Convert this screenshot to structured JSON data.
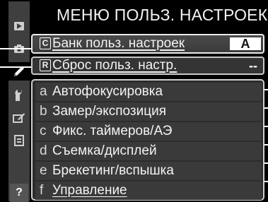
{
  "menu": {
    "title": "МЕНЮ ПОЛЬЗ. НАСТРОЕК",
    "bank_row": {
      "badge": "C",
      "label": "Банк польз. настроек",
      "value": "A"
    },
    "reset_row": {
      "badge": "R",
      "label": "Сброс польз. настр.",
      "value": "--"
    },
    "groups": [
      {
        "letter": "a",
        "label": "Автофокусировка"
      },
      {
        "letter": "b",
        "label": "Замер/экспозиция"
      },
      {
        "letter": "c",
        "label": "Фикс. таймеров/АЭ"
      },
      {
        "letter": "d",
        "label": "Съемка/дисплей"
      },
      {
        "letter": "e",
        "label": "Брекетинг/вспышка"
      },
      {
        "letter": "f",
        "label": "Управление"
      }
    ]
  },
  "tabs": [
    {
      "icon": "play-icon"
    },
    {
      "icon": "camera-icon"
    },
    {
      "icon": "pencil-icon"
    },
    {
      "icon": "wrench-icon"
    },
    {
      "icon": "retouch-icon"
    },
    {
      "icon": "my-menu-icon"
    },
    {
      "icon": "help-icon",
      "label": "?"
    }
  ]
}
